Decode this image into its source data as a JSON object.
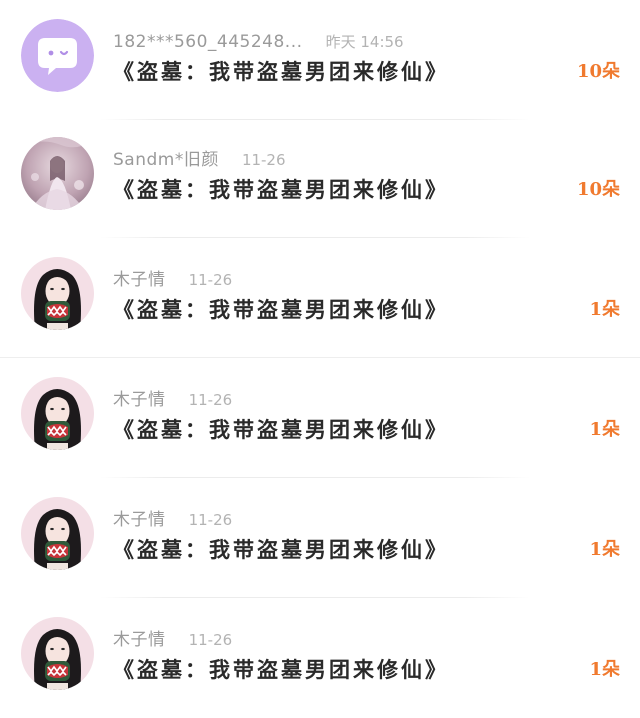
{
  "items": [
    {
      "user": "182***560_445248...",
      "time": "昨天 14:56",
      "book": "《盗墓：我带盗墓男团来修仙》",
      "count": "10朵",
      "avatar": "chat-bubble-avatar"
    },
    {
      "user": "Sandm*旧颜",
      "time": "11-26",
      "book": "《盗墓：我带盗墓男团来修仙》",
      "count": "10朵",
      "avatar": "photo-avatar"
    },
    {
      "user": "木子情",
      "time": "11-26",
      "book": "《盗墓：我带盗墓男团来修仙》",
      "count": "1朵",
      "avatar": "photo-avatar"
    },
    {
      "user": "木子情",
      "time": "11-26",
      "book": "《盗墓：我带盗墓男团来修仙》",
      "count": "1朵",
      "avatar": "photo-avatar"
    },
    {
      "user": "木子情",
      "time": "11-26",
      "book": "《盗墓：我带盗墓男团来修仙》",
      "count": "1朵",
      "avatar": "photo-avatar"
    },
    {
      "user": "木子情",
      "time": "11-26",
      "book": "《盗墓：我带盗墓男团来修仙》",
      "count": "1朵",
      "avatar": "photo-avatar"
    }
  ],
  "colors": {
    "count": "#f07a2f",
    "name": "#9a9a9a",
    "title": "#2a2a2a",
    "bubble_bg": "#c9aef0"
  }
}
